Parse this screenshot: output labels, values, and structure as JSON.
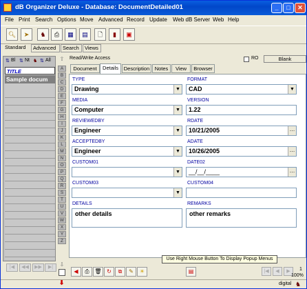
{
  "window": {
    "title": "dB Organizer Deluxe - Database: DocumentDetailed01"
  },
  "menu": [
    "File",
    "Print",
    "Search",
    "Options",
    "Move",
    "Advanced",
    "Record",
    "Update",
    "Web dB Server",
    "Web",
    "Help"
  ],
  "mode_tabs": [
    "Standard",
    "Advanced",
    "Search",
    "Views"
  ],
  "left_panel": {
    "icon_labels": [
      "Bl",
      "Nt",
      "All"
    ],
    "header": "TITLE",
    "selected_item": "Sample docum"
  },
  "alpha_index": [
    "A",
    "B",
    "C",
    "D",
    "E",
    "F",
    "G",
    "H",
    "I",
    "J",
    "K",
    "L",
    "M",
    "N",
    "O",
    "P",
    "Q",
    "R",
    "S",
    "T",
    "U",
    "V",
    "W",
    "X",
    "Y",
    "Z"
  ],
  "access": {
    "status": "Read/Write Access",
    "ro_label": "RO",
    "blank_button": "Blank"
  },
  "record_tabs": [
    "Document",
    "Details",
    "Description",
    "Notes",
    "View",
    "Browser"
  ],
  "fields": {
    "type": {
      "label": "TYPE",
      "value": "Drawing"
    },
    "format": {
      "label": "FORMAT",
      "value": "CAD"
    },
    "media": {
      "label": "MEDIA",
      "value": "Computer"
    },
    "version": {
      "label": "VERSION",
      "value": "1.22"
    },
    "reviewedby": {
      "label": "REVIEWEDBY",
      "value": "Engineer"
    },
    "rdate": {
      "label": "RDATE",
      "value": "10/21/2005"
    },
    "acceptedby": {
      "label": "ACCEPTEDBY",
      "value": "Engineer"
    },
    "adate": {
      "label": "ADATE",
      "value": "10/26/2005"
    },
    "custom01": {
      "label": "CUSTOM01",
      "value": ""
    },
    "date02": {
      "label": "DATE02",
      "value": "__/__/____"
    },
    "custom03": {
      "label": "CUSTOM03",
      "value": ""
    },
    "custom04": {
      "label": "CUSTOM04",
      "value": ""
    },
    "details": {
      "label": "DETAILS",
      "value": "other details"
    },
    "remarks": {
      "label": "REMARKS",
      "value": "other remarks"
    }
  },
  "hint": "Use Right Mouse Button To Display Popup Menus",
  "status": {
    "record": "1",
    "zoom": "100%",
    "mode": "digital"
  }
}
